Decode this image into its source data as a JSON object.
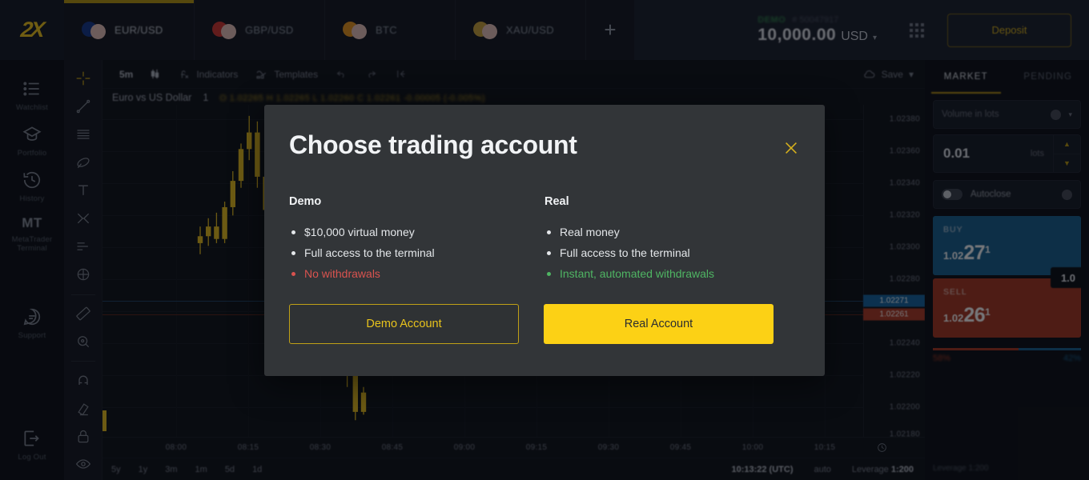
{
  "app": {
    "logo": "2X"
  },
  "topbar": {
    "tabs": [
      {
        "label": "EUR/USD",
        "icon": "flag-pair-eu-us",
        "active": true
      },
      {
        "label": "GBP/USD",
        "icon": "flag-pair-gb-us",
        "active": false
      },
      {
        "label": "BTC",
        "icon": "flag-pair-btc-us",
        "active": false
      },
      {
        "label": "XAU/USD",
        "icon": "flag-pair-gold-us",
        "active": false
      }
    ],
    "add_tab": "+",
    "account": {
      "type": "DEMO",
      "number": "# 50047917",
      "balance": "10,000.00",
      "currency": "USD",
      "caret": "▾"
    },
    "apps_icon": "grid-apps-icon",
    "deposit_label": "Deposit"
  },
  "leftnav": {
    "items": [
      {
        "label": "Watchlist",
        "icon": "watchlist-icon"
      },
      {
        "label": "Portfolio",
        "icon": "portfolio-icon"
      },
      {
        "label": "History",
        "icon": "history-clock-icon"
      },
      {
        "label": "MetaTrader Terminal",
        "icon": "mt-text-icon",
        "badge": "MT"
      },
      {
        "label": "Support",
        "icon": "support-chat-icon"
      },
      {
        "label": "Log Out",
        "icon": "logout-icon"
      }
    ]
  },
  "drawtools": {
    "items": [
      "crosshair-icon",
      "trendline-icon",
      "parallel-channel-icon",
      "pitchfork-icon",
      "text-icon",
      "fibonacci-icon",
      "levels-icon",
      "shapes-icon",
      "ruler-icon",
      "magnifier-icon",
      "magnet-icon",
      "eraser-icon",
      "lock-icon",
      "eye-icon"
    ]
  },
  "chart": {
    "toolbar": {
      "timeframe": "5m",
      "chart_type_icon": "candlestick-icon",
      "indicators": "Indicators",
      "indicators_icon": "function-icon",
      "templates": "Templates",
      "templates_icon": "template-wave-icon",
      "undo_icon": "undo-icon",
      "redo_icon": "redo-icon",
      "reset_icon": "reset-icon",
      "save": "Save",
      "save_icon": "cloud-save-icon",
      "save_caret": "▾"
    },
    "pair_title": "Euro vs US Dollar",
    "pair_interval": "1",
    "ohlc": "O 1.02265  H 1.02265  L 1.02260  C 1.02261  -0.00005 (-0.005%)",
    "price_ticks": [
      "1.02380",
      "1.02360",
      "1.02340",
      "1.02320",
      "1.02300",
      "1.02280",
      "1.02240",
      "1.02220",
      "1.02200",
      "1.02180"
    ],
    "buy_badge": "1.02271",
    "sell_badge": "1.02261",
    "time_ticks": [
      "08:00",
      "08:15",
      "08:30",
      "08:45",
      "09:00",
      "09:15",
      "09:30",
      "09:45",
      "10:00",
      "10:15"
    ],
    "ranges": [
      "5y",
      "1y",
      "3m",
      "1m",
      "5d",
      "1d"
    ],
    "status": {
      "time": "10:13:22 (UTC)",
      "auto": "auto",
      "leverage_label": "Leverage",
      "leverage_value": "1:200"
    }
  },
  "chart_data": {
    "type": "candlestick",
    "title": "Euro vs US Dollar",
    "xlabel": "",
    "ylabel": "",
    "ylim": [
      1.0216,
      1.024
    ],
    "xticks": [
      "08:00",
      "08:15",
      "08:30",
      "08:45",
      "09:00",
      "09:15",
      "09:30",
      "09:45",
      "10:00",
      "10:15"
    ],
    "yticks": [
      1.0238,
      1.0236,
      1.0234,
      1.0232,
      1.023,
      1.0228,
      1.0224,
      1.0222,
      1.022,
      1.0218
    ],
    "grid": true,
    "candles": [
      {
        "o": 1.023,
        "h": 1.02312,
        "l": 1.02292,
        "c": 1.02305
      },
      {
        "o": 1.02305,
        "h": 1.02318,
        "l": 1.02298,
        "c": 1.02312
      },
      {
        "o": 1.02312,
        "h": 1.02322,
        "l": 1.023,
        "c": 1.02303
      },
      {
        "o": 1.02303,
        "h": 1.0233,
        "l": 1.023,
        "c": 1.02326
      },
      {
        "o": 1.02326,
        "h": 1.02352,
        "l": 1.0232,
        "c": 1.02345
      },
      {
        "o": 1.02345,
        "h": 1.02372,
        "l": 1.0234,
        "c": 1.02368
      },
      {
        "o": 1.02368,
        "h": 1.02392,
        "l": 1.0236,
        "c": 1.0238
      },
      {
        "o": 1.0238,
        "h": 1.02388,
        "l": 1.0234,
        "c": 1.02348
      },
      {
        "o": 1.02348,
        "h": 1.02356,
        "l": 1.02318,
        "c": 1.02324
      },
      {
        "o": 1.02324,
        "h": 1.0234,
        "l": 1.02312,
        "c": 1.02336
      },
      {
        "o": 1.02336,
        "h": 1.02344,
        "l": 1.023,
        "c": 1.02306
      },
      {
        "o": 1.02306,
        "h": 1.02316,
        "l": 1.02286,
        "c": 1.02292
      },
      {
        "o": 1.02292,
        "h": 1.02318,
        "l": 1.02288,
        "c": 1.02314
      },
      {
        "o": 1.02314,
        "h": 1.02322,
        "l": 1.02276,
        "c": 1.02282
      },
      {
        "o": 1.02282,
        "h": 1.02294,
        "l": 1.02268,
        "c": 1.02276
      },
      {
        "o": 1.02276,
        "h": 1.02286,
        "l": 1.0224,
        "c": 1.02246
      },
      {
        "o": 1.02246,
        "h": 1.02262,
        "l": 1.02236,
        "c": 1.02256
      },
      {
        "o": 1.02256,
        "h": 1.02264,
        "l": 1.02214,
        "c": 1.0222
      },
      {
        "o": 1.0222,
        "h": 1.02232,
        "l": 1.02196,
        "c": 1.02204
      },
      {
        "o": 1.02204,
        "h": 1.0221,
        "l": 1.02172,
        "c": 1.02178
      },
      {
        "o": 1.02178,
        "h": 1.02196,
        "l": 1.02176,
        "c": 1.02192
      }
    ],
    "buy_line": 1.02271,
    "sell_line": 1.02261
  },
  "rightpanel": {
    "tabs": [
      {
        "label": "MARKET",
        "active": true
      },
      {
        "label": "PENDING",
        "active": false
      }
    ],
    "volume_label": "Volume in lots",
    "volume_value": "0.01",
    "volume_unit": "lots",
    "step_up": "▲",
    "step_down": "▼",
    "autoclose_label": "Autoclose",
    "buy": {
      "label": "BUY",
      "prefix": "1.02",
      "big": "27",
      "sup": "1"
    },
    "sell": {
      "label": "SELL",
      "prefix": "1.02",
      "big": "26",
      "sup": "1"
    },
    "spread": "1.0",
    "ratio": {
      "sell_pct": "58%",
      "buy_pct": "42%",
      "sell_value": 58,
      "buy_value": 42
    },
    "leverage": "Leverage 1:200"
  },
  "modal": {
    "title": "Choose trading account",
    "close_icon": "close-x-icon",
    "columns": [
      {
        "head": "Demo",
        "items": [
          {
            "text": "$10,000 virtual money",
            "tone": "neutral"
          },
          {
            "text": "Full access to the terminal",
            "tone": "neutral"
          },
          {
            "text": "No withdrawals",
            "tone": "negative"
          }
        ],
        "button": "Demo Account",
        "button_style": "outline"
      },
      {
        "head": "Real",
        "items": [
          {
            "text": "Real money",
            "tone": "neutral"
          },
          {
            "text": "Full access to the terminal",
            "tone": "neutral"
          },
          {
            "text": "Instant, automated withdrawals",
            "tone": "positive"
          }
        ],
        "button": "Real Account",
        "button_style": "solid"
      }
    ]
  },
  "colors": {
    "accent": "#fcd115",
    "accent_dim": "#c29b12",
    "buy": "#17608f",
    "sell": "#a6361f",
    "positive": "#4fb563",
    "negative": "#d9534f",
    "modal_bg": "#323538"
  }
}
